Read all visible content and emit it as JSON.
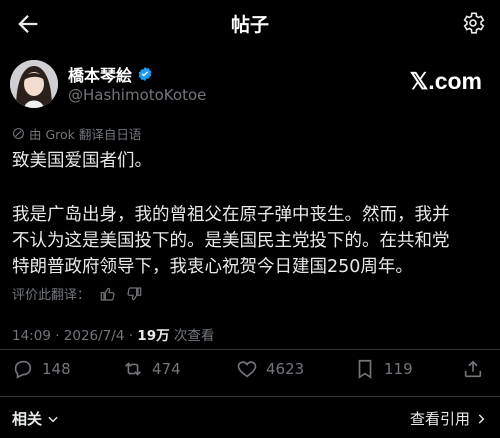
{
  "header": {
    "title": "帖子",
    "back_icon": "back-arrow-icon",
    "settings_icon": "gear-icon"
  },
  "author": {
    "name": "橋本琴絵",
    "handle": "@HashimotoKotoe",
    "verified": true,
    "verified_color": "#1d9bf0"
  },
  "brand": {
    "text": "𝕏.com"
  },
  "translation": {
    "label": "由 Grok 翻译自日语"
  },
  "post": {
    "line1": "致美国爱国者们。",
    "paragraph2": "我是广岛出身，我的曾祖父在原子弹中丧生。然而，我并\n不认为这是美国投下的。是美国民主党投下的。在共和党\n特朗普政府领导下，我衷心祝贺今日建国250周年。"
  },
  "rating": {
    "label": "评价此翻译："
  },
  "meta": {
    "time": "14:09 · 2026/7/4 · ",
    "views_count": "19万",
    "views_label": " 次查看"
  },
  "actions": {
    "replies": "148",
    "reposts": "474",
    "likes": "4623",
    "bookmarks": "119"
  },
  "footer": {
    "related": "相关",
    "quotes": "查看引用"
  },
  "colors": {
    "background": "#000000",
    "muted": "#71767b",
    "text": "#e7e9ea",
    "divider": "#2f3336"
  }
}
